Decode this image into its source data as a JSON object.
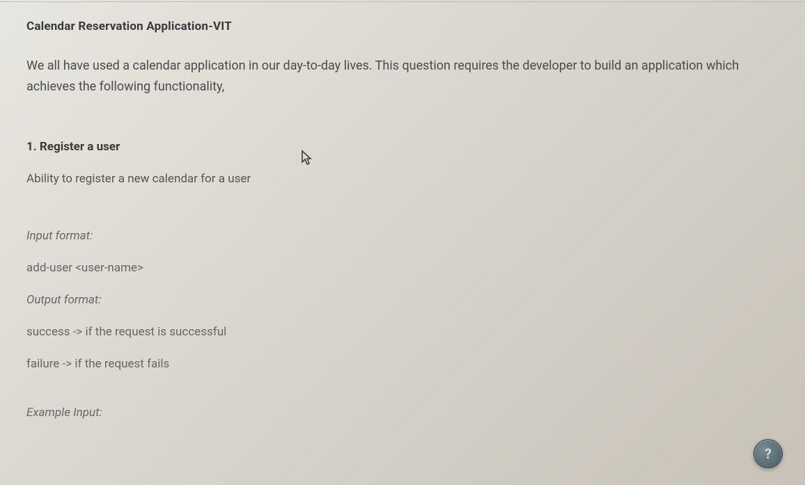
{
  "title": "Calendar Reservation Application-VIT",
  "intro": "We all have used a calendar application in our day-to-day lives. This question requires the developer to build an application which achieves the following functionality,",
  "section": {
    "heading": "1. Register a user",
    "desc": "Ability to register a new calendar for a user"
  },
  "input": {
    "label": "Input format:",
    "content": "add-user <user-name>"
  },
  "output": {
    "label": "Output format:",
    "line1": "success -> if the request is successful",
    "line2": "failure -> if the request fails"
  },
  "example": {
    "label": "Example Input:"
  },
  "help": {
    "symbol": "?"
  }
}
